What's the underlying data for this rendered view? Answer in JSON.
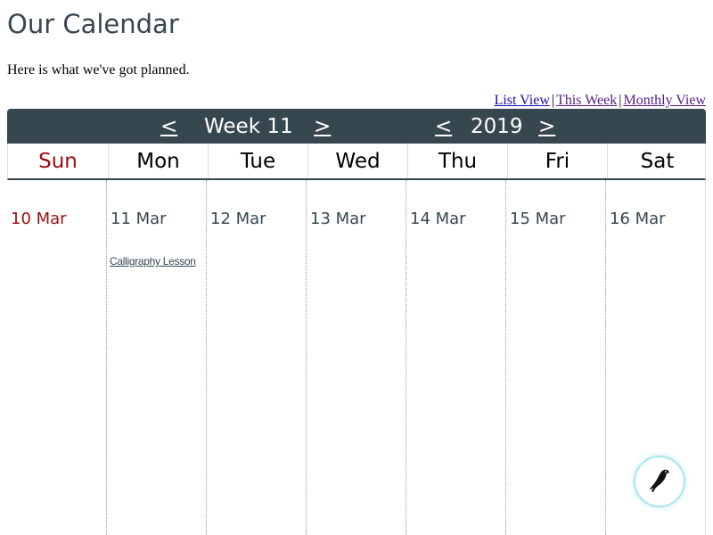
{
  "page": {
    "title": "Our Calendar",
    "intro": "Here is what we've got planned."
  },
  "views": {
    "list": "List View",
    "sep1": "|",
    "week": "This Week",
    "sep2": "|",
    "month": "Monthly View"
  },
  "nav": {
    "prev_week": "<",
    "week_label": "Week 11",
    "next_week": ">",
    "prev_year": "<",
    "year_label": "2019",
    "next_year": ">"
  },
  "days": [
    {
      "name": "Sun",
      "date": "10 Mar",
      "events": []
    },
    {
      "name": "Mon",
      "date": "11 Mar",
      "events": [
        "Calligraphy Lesson"
      ]
    },
    {
      "name": "Tue",
      "date": "12 Mar",
      "events": []
    },
    {
      "name": "Wed",
      "date": "13 Mar",
      "events": []
    },
    {
      "name": "Thu",
      "date": "14 Mar",
      "events": []
    },
    {
      "name": "Fri",
      "date": "15 Mar",
      "events": []
    },
    {
      "name": "Sat",
      "date": "16 Mar",
      "events": []
    }
  ],
  "colors": {
    "header_bg": "#37474f",
    "sunday": "#9b0d0d",
    "text": "#37474f",
    "link": "#1a0dab",
    "visited_link": "#551a8b"
  },
  "icons": {
    "floating_button": "bird-logo-icon"
  }
}
